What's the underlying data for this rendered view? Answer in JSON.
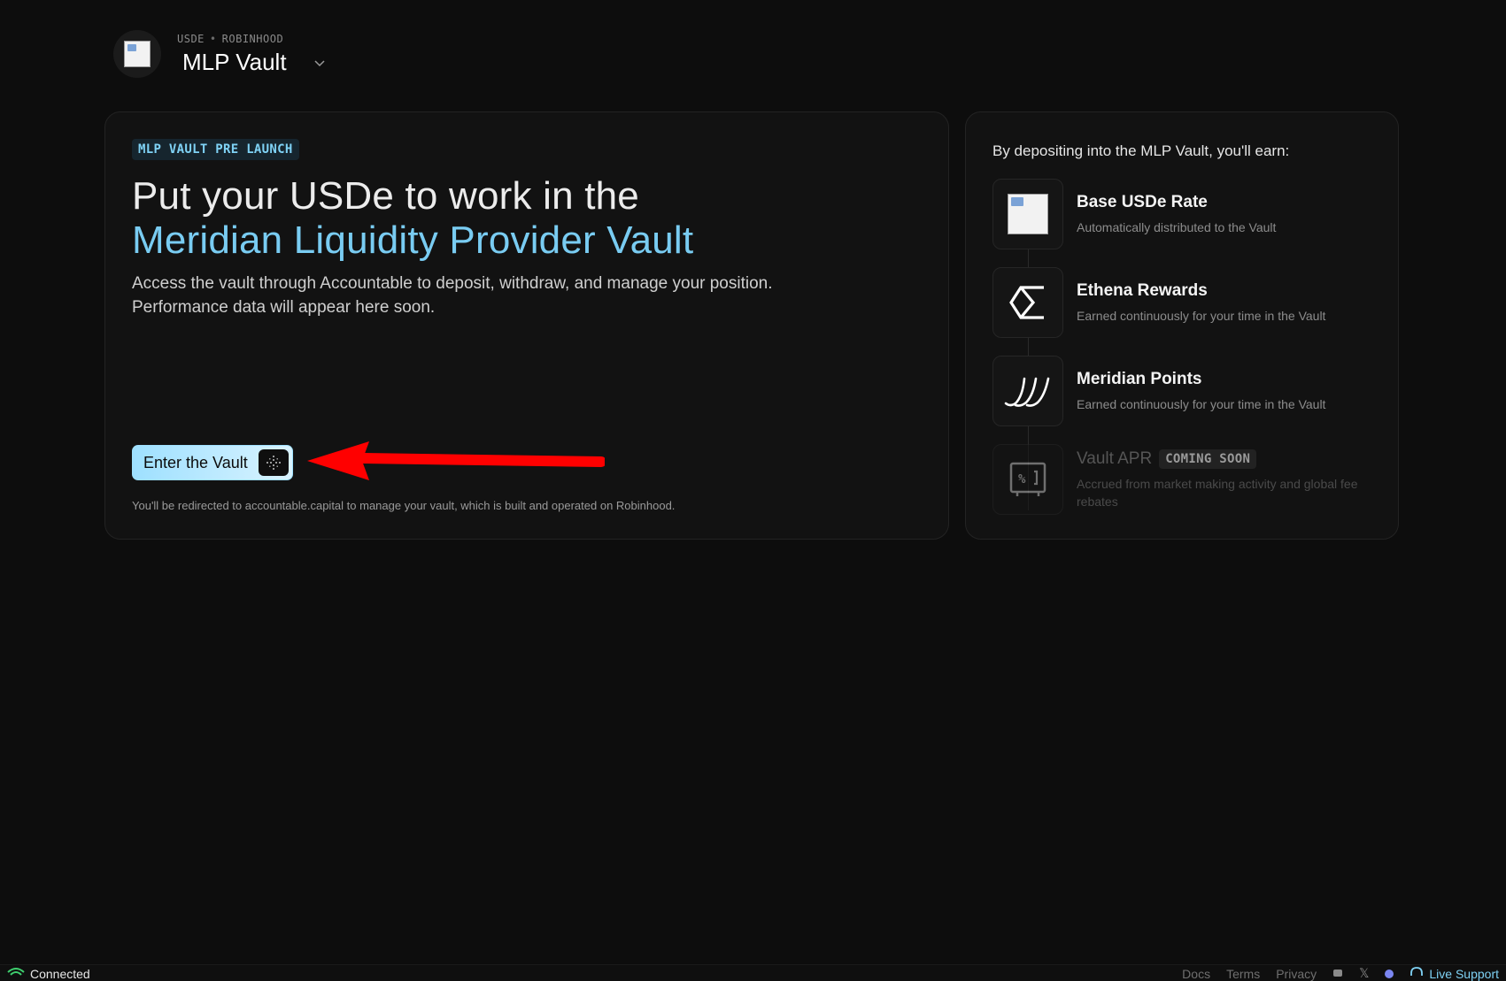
{
  "header": {
    "token": "USDE",
    "separator": "•",
    "chain": "ROBINHOOD",
    "title": "MLP Vault",
    "logo_icon": "broken-image-icon"
  },
  "main": {
    "badge": "MLP VAULT PRE LAUNCH",
    "headline_line1": "Put your USDe to work in the",
    "headline_line2": "Meridian Liquidity Provider Vault",
    "description_line1": "Access the vault through Accountable to deposit, withdraw, and manage your position.",
    "description_line2": "Performance data will appear here soon.",
    "enter_button_label": "Enter the Vault",
    "redirect_note": "You'll be redirected to accountable.capital to manage your vault, which is built and operated on Robinhood."
  },
  "earnings": {
    "heading": "By depositing into the MLP Vault, you'll earn:",
    "items": [
      {
        "title": "Base USDe Rate",
        "description": "Automatically distributed to the Vault",
        "icon": "broken-image-icon"
      },
      {
        "title": "Ethena Rewards",
        "description": "Earned continuously for your time in the Vault",
        "icon": "ethena-logo-icon"
      },
      {
        "title": "Meridian Points",
        "description": "Earned continuously for your time in the Vault",
        "icon": "meridian-logo-icon"
      },
      {
        "title": "Vault APR",
        "badge": "COMING SOON",
        "description": "Accrued from market making activity and global fee rebates",
        "icon": "percent-safe-icon"
      }
    ]
  },
  "footer": {
    "status": "Connected",
    "links": [
      "Docs",
      "Terms",
      "Privacy"
    ],
    "live_support": "Live Support"
  },
  "colors": {
    "background": "#0d0d0d",
    "card": "#121212",
    "accent": "#79ccf2",
    "annotation_arrow": "#ff0000"
  }
}
